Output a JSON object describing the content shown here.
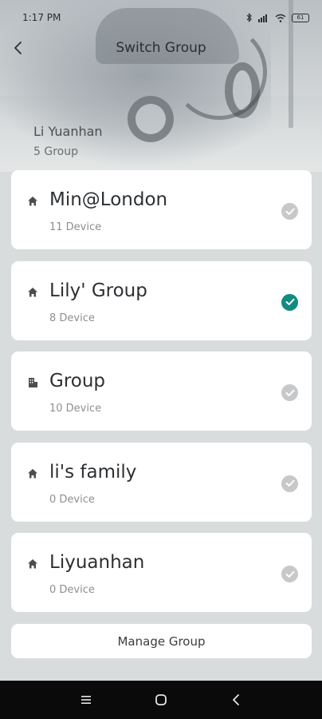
{
  "status_bar": {
    "time": "1:17 PM",
    "battery": "61"
  },
  "header": {
    "title": "Switch Group"
  },
  "user": {
    "name": "Li Yuanhan",
    "group_count": "5 Group"
  },
  "groups": [
    {
      "name": "Min@London",
      "devices": "11 Device",
      "icon": "home-icon",
      "selected": false
    },
    {
      "name": "Lily' Group",
      "devices": "8 Device",
      "icon": "home-icon",
      "selected": true
    },
    {
      "name": "Group",
      "devices": "10 Device",
      "icon": "building-icon",
      "selected": false
    },
    {
      "name": "li's family",
      "devices": "0 Device",
      "icon": "home-icon",
      "selected": false
    },
    {
      "name": "Liyuanhan",
      "devices": "0 Device",
      "icon": "home-icon",
      "selected": false
    }
  ],
  "manage_button": {
    "label": "Manage Group"
  },
  "colors": {
    "accent": "#128b80",
    "unselected_check": "#c6c8ca",
    "background": "#d9dcdd"
  }
}
